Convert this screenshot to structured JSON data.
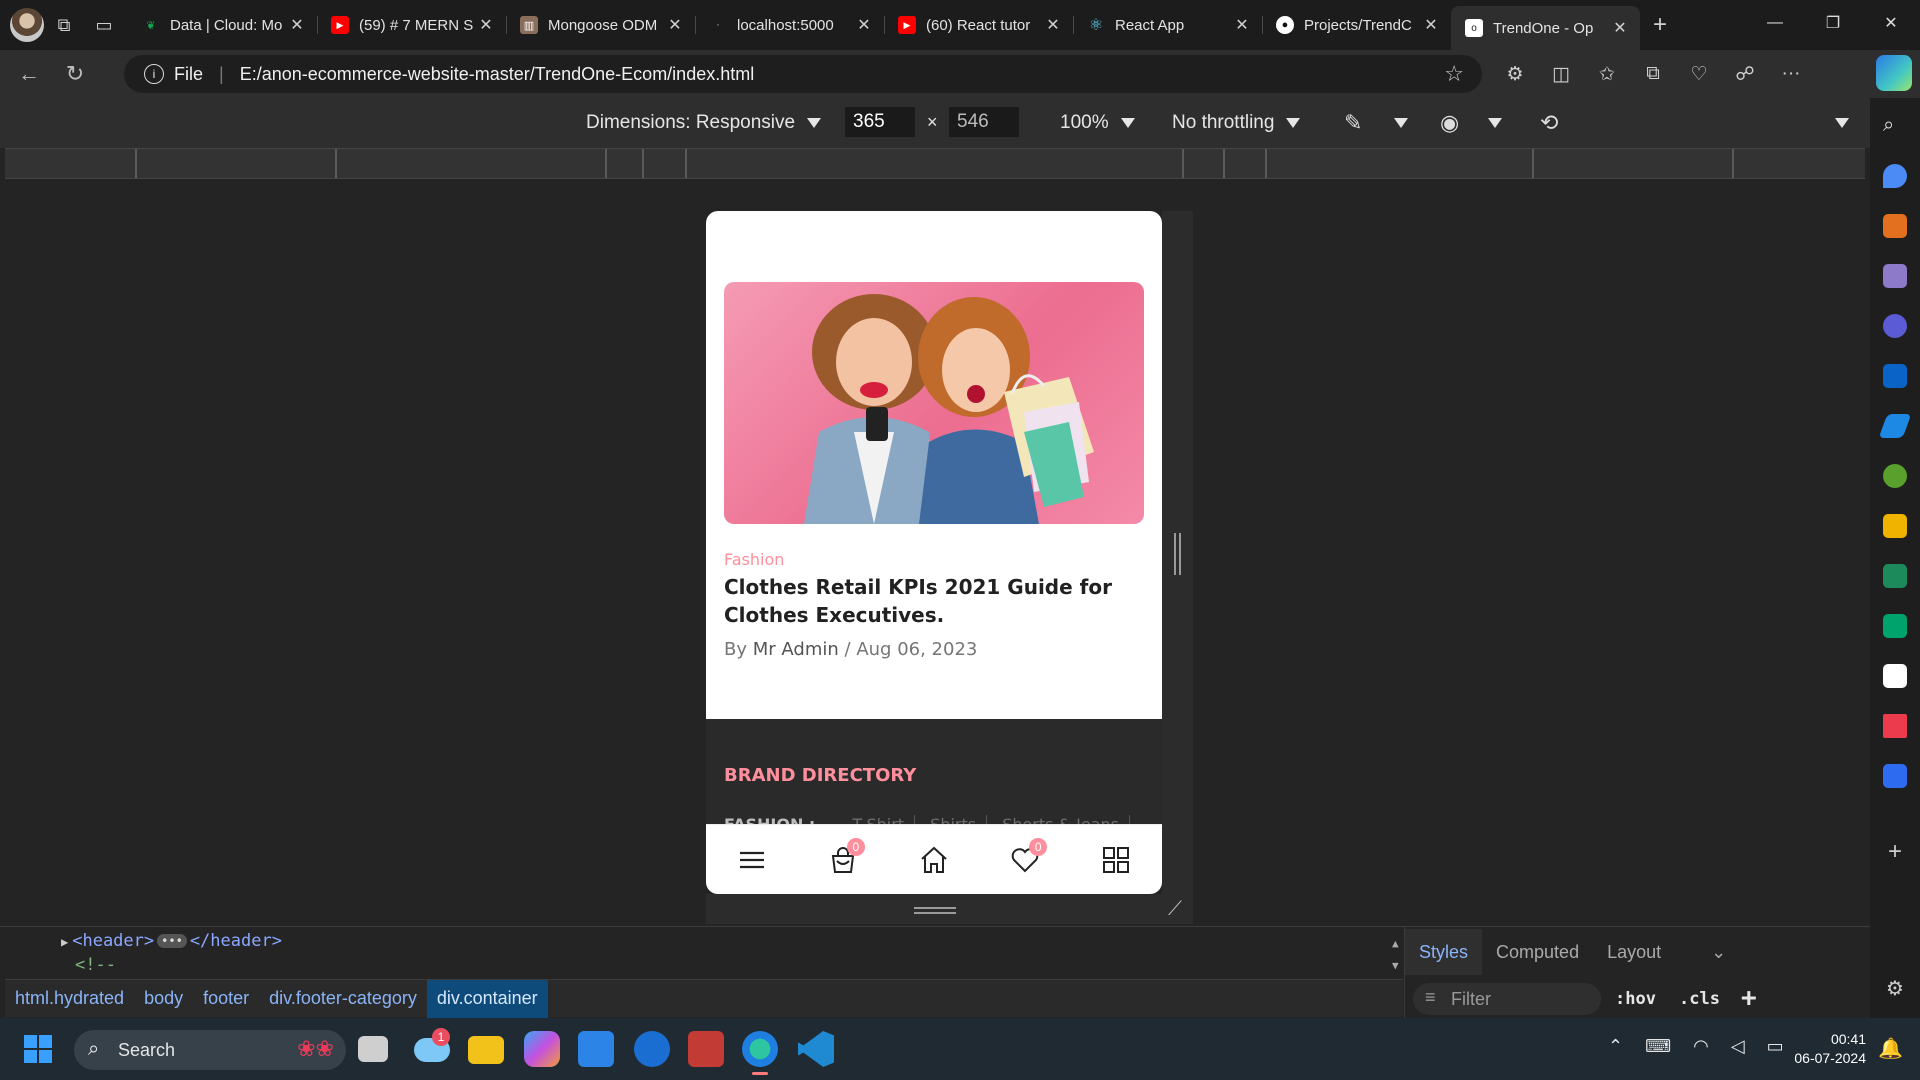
{
  "browser": {
    "tabs": [
      {
        "title": "Data | Cloud: Mo",
        "favicon": "mongodb-leaf-icon",
        "color": "#13aa52"
      },
      {
        "title": "(59) # 7 MERN S",
        "favicon": "youtube-icon",
        "color": "#ff0000"
      },
      {
        "title": "Mongoose ODM",
        "favicon": "mongoose-icon",
        "color": "#8a6e5c"
      },
      {
        "title": "localhost:5000",
        "favicon": "loading-icon",
        "color": "#888888"
      },
      {
        "title": "(60) React tutor",
        "favicon": "youtube-icon",
        "color": "#ff0000"
      },
      {
        "title": "React App",
        "favicon": "react-icon",
        "color": "#61dafb"
      },
      {
        "title": "Projects/TrendC",
        "favicon": "github-icon",
        "color": "#ffffff"
      },
      {
        "title": "TrendOne - Op",
        "favicon": "trendone-icon",
        "color": "#ffffff",
        "active": true
      }
    ],
    "address": {
      "scheme_label": "File",
      "url": "E:/anon-ecommerce-website-master/TrendOne-Ecom/index.html"
    }
  },
  "device_toolbar": {
    "dimensions_label": "Dimensions: Responsive",
    "width": "365",
    "times": "×",
    "height": "546",
    "zoom": "100%",
    "throttling": "No throttling"
  },
  "page": {
    "blog": {
      "category": "Fashion",
      "title": "Clothes Retail KPIs 2021 Guide for Clothes Executives.",
      "meta_by": "By",
      "author": "Mr Admin",
      "meta_sep": "/",
      "date": "Aug 06, 2023"
    },
    "footer": {
      "brand_directory_title": "BRAND DIRECTORY",
      "fashion_label": "FASHION :",
      "fashion_links": [
        "T-Shirt",
        "Shirts",
        "Shorts & Jeans"
      ]
    },
    "mobile_nav": {
      "cart_count": "0",
      "wishlist_count": "0"
    },
    "colors": {
      "accent": "#ff8f9c",
      "footer_bg": "#2a2a2a",
      "banner_bg": "#ec6d90"
    }
  },
  "devtools": {
    "element_line1_open": "<header>",
    "element_line1_close": "</header>",
    "element_line2": "<!--",
    "breadcrumbs": [
      "html.hydrated",
      "body",
      "footer",
      "div.footer-category",
      "div.container"
    ],
    "style_tabs": [
      "Styles",
      "Computed",
      "Layout"
    ],
    "filter_placeholder": "Filter",
    "hov": ":hov",
    "cls": ".cls"
  },
  "taskbar": {
    "search_label": "Search",
    "time": "00:41",
    "date": "06-07-2024",
    "weather_badge": "1"
  }
}
